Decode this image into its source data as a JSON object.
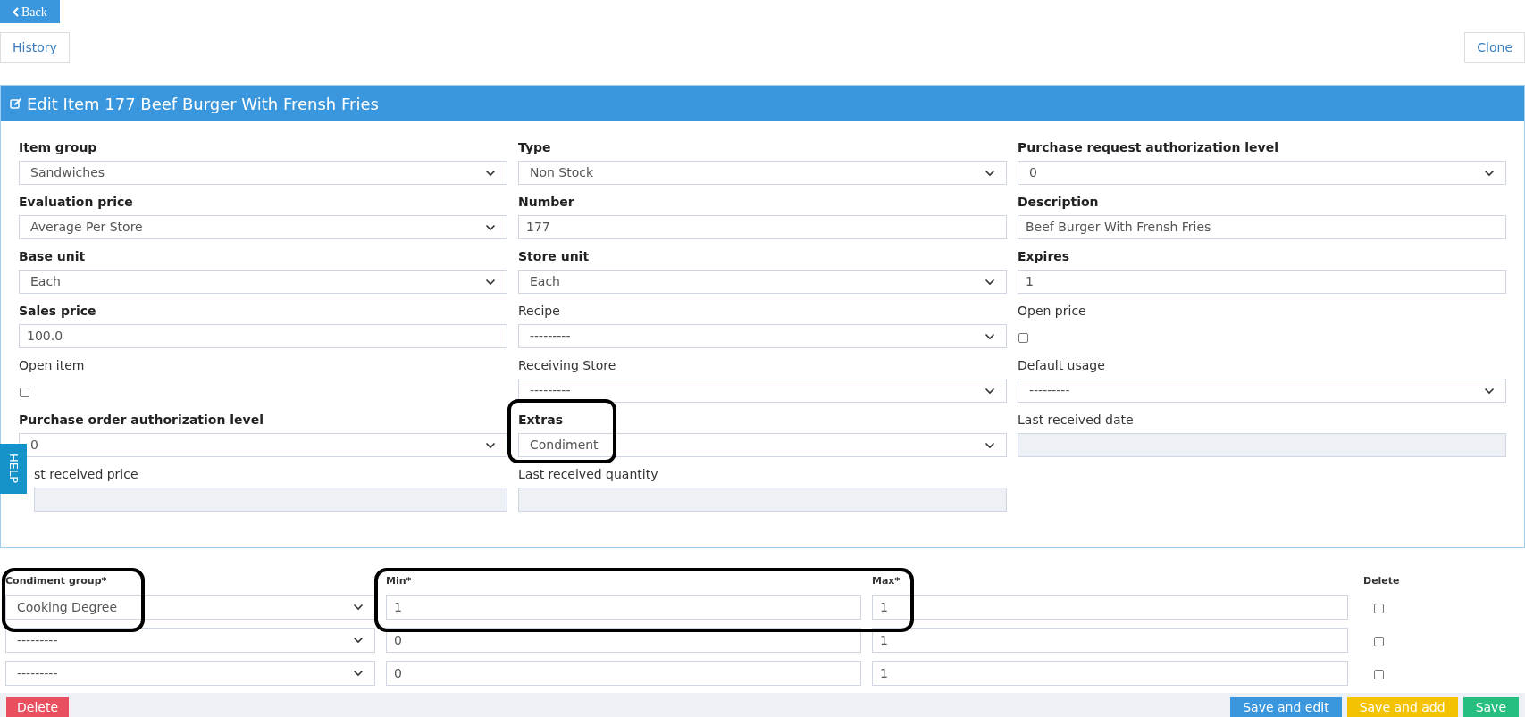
{
  "back_button": "Back",
  "history_button": "History",
  "clone_button": "Clone",
  "help_tab": "HELP",
  "panel": {
    "title": "Edit Item 177 Beef Burger With Frensh Fries",
    "fields": [
      {
        "label": "Item group",
        "bold": true,
        "kind": "select",
        "value": "Sandwiches"
      },
      {
        "label": "Type",
        "bold": true,
        "kind": "select",
        "value": "Non Stock"
      },
      {
        "label": "Purchase request authorization level",
        "bold": true,
        "kind": "select",
        "value": "0"
      },
      {
        "label": "Evaluation price",
        "bold": true,
        "kind": "select",
        "value": "Average Per Store"
      },
      {
        "label": "Number",
        "bold": true,
        "kind": "input",
        "value": "177"
      },
      {
        "label": "Description",
        "bold": true,
        "kind": "input",
        "value": "Beef Burger With Frensh Fries"
      },
      {
        "label": "Base unit",
        "bold": true,
        "kind": "select",
        "value": "Each"
      },
      {
        "label": "Store unit",
        "bold": true,
        "kind": "select",
        "value": "Each"
      },
      {
        "label": "Expires",
        "bold": true,
        "kind": "input",
        "value": "1"
      },
      {
        "label": "Sales price",
        "bold": true,
        "kind": "input",
        "value": "100.0"
      },
      {
        "label": "Recipe",
        "bold": false,
        "kind": "select",
        "value": "---------"
      },
      {
        "label": "Open price",
        "bold": false,
        "kind": "checkbox",
        "checked": false
      },
      {
        "label": "Open item",
        "bold": false,
        "kind": "checkbox",
        "checked": false
      },
      {
        "label": "Receiving Store",
        "bold": false,
        "kind": "select",
        "value": "---------"
      },
      {
        "label": "Default usage",
        "bold": false,
        "kind": "select",
        "value": "---------"
      },
      {
        "label": "Purchase order authorization level",
        "bold": true,
        "kind": "select",
        "value": "0"
      },
      {
        "label": "Extras",
        "bold": true,
        "kind": "select",
        "value": "Condiment",
        "highlighted": true
      },
      {
        "label": "Last received date",
        "bold": false,
        "kind": "readonly"
      },
      {
        "label": "st received price",
        "bold": false,
        "kind": "readonly"
      },
      {
        "label": "Last received quantity",
        "bold": false,
        "kind": "readonly"
      }
    ]
  },
  "condiments": {
    "columns": [
      "Condiment group*",
      "Min*",
      "Max*",
      "Delete"
    ],
    "highlight_group": true,
    "highlight_range": true,
    "rows": [
      {
        "group": "Cooking Degree",
        "min": "1",
        "max": "1",
        "delete": false
      },
      {
        "group": "---------",
        "min": "0",
        "max": "1",
        "delete": false
      },
      {
        "group": "---------",
        "min": "0",
        "max": "1",
        "delete": false
      }
    ]
  },
  "footer_buttons": [
    {
      "label": "Delete",
      "kind": "danger"
    },
    {
      "label": "Save and edit",
      "kind": "primary"
    },
    {
      "label": "Save and add",
      "kind": "warning"
    },
    {
      "label": "Save",
      "kind": "success"
    }
  ]
}
